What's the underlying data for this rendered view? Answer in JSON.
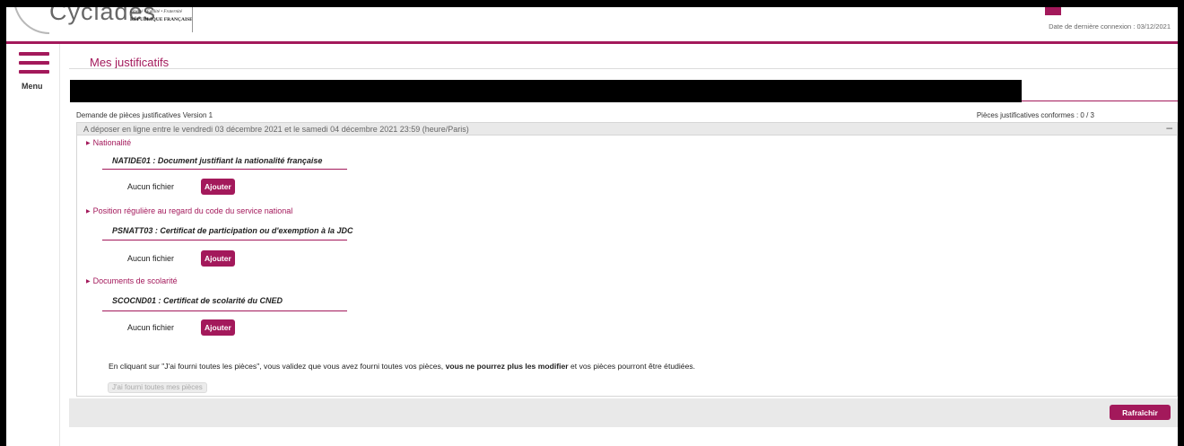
{
  "header": {
    "brand": "Cyclades",
    "motto": "Liberté • Égalité • Fraternité",
    "republic": "RÉPUBLIQUE FRANÇAISE",
    "last_login": "Date de dernière connexion : 03/12/2021"
  },
  "menu": {
    "label": "Menu"
  },
  "page": {
    "title": "Mes justificatifs",
    "request_version": "Demande de pièces justificatives Version 1",
    "pieces_count": "Pièces justificatives conformes : 0 / 3"
  },
  "panel": {
    "header_text": "A déposer en ligne entre le vendredi 03 décembre 2021 et le samedi 04 décembre 2021 23:59 (heure/Paris)",
    "collapse_symbol": "–",
    "sections": [
      {
        "label": "Nationalité",
        "doc_title": "NATIDE01 : Document justifiant la nationalité française",
        "no_file": "Aucun fichier",
        "add_label": "Ajouter"
      },
      {
        "label": "Position régulière au regard du code du service national",
        "doc_title": "PSNATT03 : Certificat de participation ou d'exemption à la JDC",
        "no_file": "Aucun fichier",
        "add_label": "Ajouter"
      },
      {
        "label": "Documents de scolarité",
        "doc_title": "SCOCND01 : Certificat de scolarité du CNED",
        "no_file": "Aucun fichier",
        "add_label": "Ajouter"
      }
    ],
    "notice": {
      "part1": "En cliquant sur \"J'ai fourni toutes les pièces\", vous validez que vous avez fourni toutes vos pièces, ",
      "bold": "vous ne pourrez plus les modifier",
      "part2": " et vos pièces pourront être étudiées."
    },
    "submit_label": "J'ai fourni toutes mes pièces"
  },
  "footer": {
    "refresh_label": "Rafraîchir"
  },
  "colors": {
    "accent": "#a3195b",
    "panel_header_bg": "#e9e9e9",
    "frame": "#000000"
  }
}
